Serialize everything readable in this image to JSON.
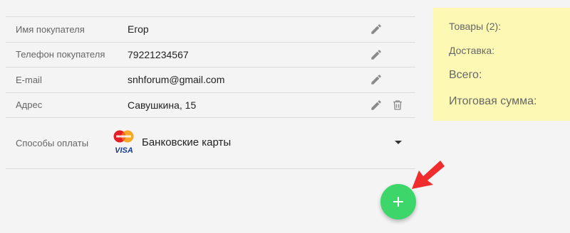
{
  "customer": {
    "rows": [
      {
        "label": "Имя покупателя",
        "value": "Егор"
      },
      {
        "label": "Телефон покупателя",
        "value": "79221234567"
      },
      {
        "label": "E-mail",
        "value": "snhforum@gmail.com"
      },
      {
        "label": "Адрес",
        "value": "Савушкина, 15"
      }
    ]
  },
  "payment": {
    "label": "Способы оплаты",
    "selected": "Банковские карты",
    "logo_text": "VISA"
  },
  "summary": {
    "items": "Товары (2):",
    "delivery": "Доставка:",
    "total": "Всего:",
    "grand_total": "Итоговая сумма:"
  },
  "icons": {
    "edit": "pencil-icon",
    "delete": "trash-icon",
    "add": "plus-icon",
    "dropdown": "caret-down-icon",
    "annotation": "red-arrow"
  },
  "colors": {
    "fab": "#3dd66b",
    "summary_bg": "#fdf9b5",
    "arrow": "#f02d2d"
  }
}
